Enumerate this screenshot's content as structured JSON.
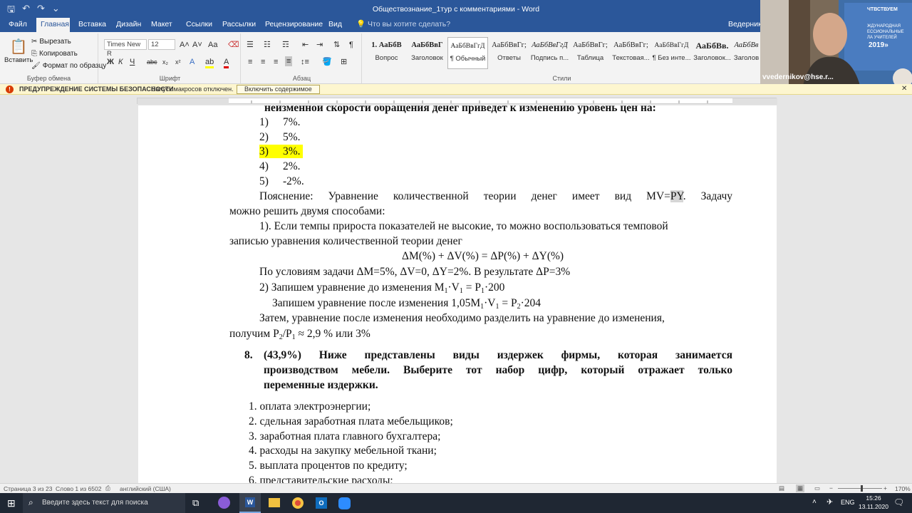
{
  "title_bar": {
    "title": "Обществознание_1тур с комментариями - Word"
  },
  "tabs": [
    "Файл",
    "Главная",
    "Вставка",
    "Дизайн",
    "Макет",
    "Ссылки",
    "Рассылки",
    "Рецензирование",
    "Вид"
  ],
  "tell_me": "Что вы хотите сделать?",
  "user": "Ведернико",
  "clipboard": {
    "paste": "Вставить",
    "cut": "Вырезать",
    "copy": "Копировать",
    "format_painter": "Формат по образцу",
    "label": "Буфер обмена"
  },
  "font": {
    "name": "Times New R",
    "size": "12",
    "label": "Шрифт"
  },
  "paragraph": {
    "label": "Абзац"
  },
  "styles": {
    "label": "Стили",
    "items": [
      {
        "preview": "1. АаБбВ",
        "name": "Вопрос"
      },
      {
        "preview": "АаБбВвГ",
        "name": "Заголовок"
      },
      {
        "preview": "АаБбВвГгД",
        "name": "¶ Обычный"
      },
      {
        "preview": "АаБбВвГг;",
        "name": "Ответы"
      },
      {
        "preview": "АаБбВвГгД",
        "name": "Подпись п..."
      },
      {
        "preview": "АаБбВвГг;",
        "name": "Таблица"
      },
      {
        "preview": "АаБбВвГг;",
        "name": "Текстовая..."
      },
      {
        "preview": "АаБбВвГгД",
        "name": "¶ Без инте..."
      },
      {
        "preview": "АаБбВв.",
        "name": "Заголовок..."
      },
      {
        "preview": "АаБбВв",
        "name": "Заголов"
      }
    ]
  },
  "security": {
    "title": "ПРЕДУПРЕЖДЕНИЕ СИСТЕМЫ БЕЗОПАСНОСТИ",
    "message": "Запуск макросов отключен.",
    "button": "Включить содержимое"
  },
  "webcam": {
    "email": "vvedernikov@hse.r...",
    "banner": "ЧТВСТВУЕМ",
    "banner2": "ЖДУНАРОДНАЯ",
    "banner3": "ЕССИОНАЛЬНЫЕ",
    "banner4": "ЛА УЧИТЕЛЕЙ",
    "banner5": "2019»"
  },
  "document": {
    "cut_line": "неизменной скорости обращения денег приведет к изменению уровень цен на:",
    "options": [
      {
        "n": "1)",
        "t": "7%."
      },
      {
        "n": "2)",
        "t": "5%."
      },
      {
        "n": "3)",
        "t": "3%."
      },
      {
        "n": "4)",
        "t": "2%."
      },
      {
        "n": "5)",
        "t": "-2%."
      }
    ],
    "expl_1a": "Пояснение: Уравнение количественной теории денег имеет вид MV=",
    "expl_1py": "PY",
    "expl_1b": ". Задачу",
    "expl_2": "можно решить двумя способами:",
    "method1_a": "1). Если темпы прироста показателей не высокие, то можно воспользоваться темповой",
    "method1_b": "записью уравнения количественной теории денег",
    "formula": "ΔM(%) + ΔV(%) = ΔP(%) + ΔY(%)",
    "conditions": "По условиям задачи ΔM=5%, ΔV=0, ΔY=2%. В результате ΔP=3%",
    "method2_pre": "2) Запишем уравнение до изменения M",
    "method2_mid": "·V",
    "method2_eq": " = P",
    "method2_end": "·200",
    "after_pre": "Запишем уравнение после изменения 1,05M",
    "after_end": "·204",
    "then_a": "Затем, уравнение после изменения необходимо разделить на уравнение до изменения,",
    "then_b_pre": "получим P",
    "then_b_end": " ≈ 2,9 % или 3%",
    "sub1": "1",
    "sub2": "2",
    "q8_num": "8.",
    "q8_1": "(43,9%) Ниже представлены виды издержек фирмы, которая занимается",
    "q8_2": "производством мебели. Выберите тот набор цифр, который отражает только",
    "q8_3": "переменные издержки.",
    "items": [
      "1. оплата электроэнергии;",
      "2. сдельная заработная плата мебельщиков;",
      "3. заработная плата главного бухгалтера;",
      "4. расходы на закупку мебельной ткани;",
      "5. выплата процентов по кредиту;",
      "6. представительские расходы;"
    ]
  },
  "status": {
    "page": "Страница 3 из 23",
    "words": "Слово 1 из 6502",
    "lang": "английский (США)",
    "zoom": "170%"
  },
  "taskbar": {
    "search": "Введите здесь текст для поиска",
    "lang": "ENG",
    "time": "15:26",
    "date": "13.11.2020"
  }
}
